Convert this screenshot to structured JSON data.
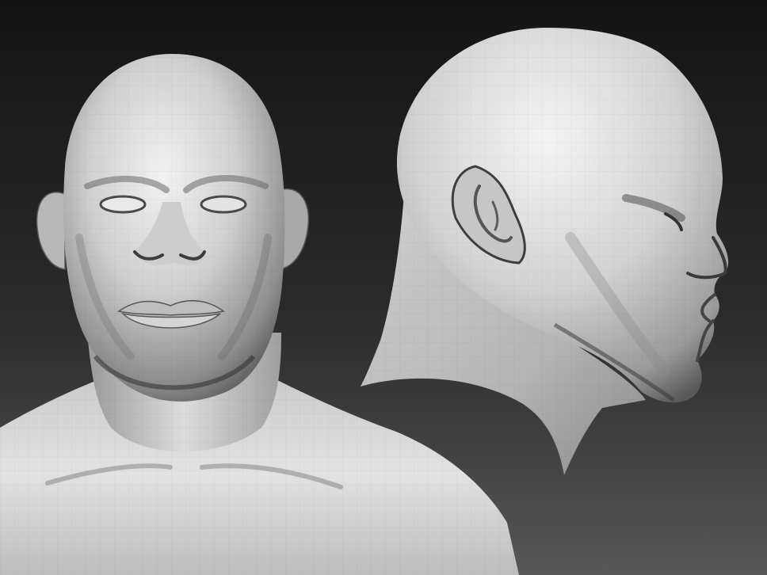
{
  "scene": {
    "background_top": "#121212",
    "background_bottom": "#5a5a5a",
    "clay_light": "#e8e8e8",
    "clay_mid": "#a8a8a8",
    "clay_dark": "#3a3a3a",
    "facet_line": "#8a8a8a"
  },
  "views": [
    {
      "name": "front-view",
      "description_icon": "head-front-sculpt"
    },
    {
      "name": "side-view",
      "description_icon": "head-profile-sculpt"
    }
  ]
}
